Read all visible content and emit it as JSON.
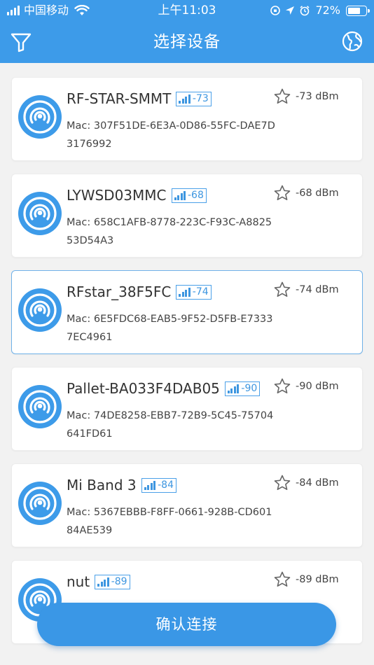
{
  "status_bar": {
    "carrier": "中国移动",
    "time": "上午11:03",
    "battery_percent": "72%",
    "battery_level": 0.72
  },
  "nav": {
    "title": "选择设备",
    "left_icon": "filter-icon",
    "right_icon": "globe-icon"
  },
  "colors": {
    "primary": "#3d9be9",
    "badge": "#3d96e0",
    "selected_border": "#6fb1e8"
  },
  "devices": [
    {
      "name": "RF-STAR-SMMT",
      "badge_rssi": "-73",
      "mac_label": "Mac: 307F51DE-6E3A-0D86-55FC-DAE7D3176992",
      "rssi_text": "-73 dBm",
      "selected": false
    },
    {
      "name": "LYWSD03MMC",
      "badge_rssi": "-68",
      "mac_label": "Mac: 658C1AFB-8778-223C-F93C-A882553D54A3",
      "rssi_text": "-68 dBm",
      "selected": false
    },
    {
      "name": "RFstar_38F5FC",
      "badge_rssi": "-74",
      "mac_label": "Mac: 6E5FDC68-EAB5-9F52-D5FB-E73337EC4961",
      "rssi_text": "-74 dBm",
      "selected": true
    },
    {
      "name": "Pallet-BA033F4DAB05",
      "badge_rssi": "-90",
      "mac_label": "Mac: 74DE8258-EBB7-72B9-5C45-75704641FD61",
      "rssi_text": "-90 dBm",
      "selected": false
    },
    {
      "name": "Mi Band 3",
      "badge_rssi": "-84",
      "mac_label": "Mac: 5367EBBB-F8FF-0661-928B-CD60184AE539",
      "rssi_text": "-84 dBm",
      "selected": false
    },
    {
      "name": "nut",
      "badge_rssi": "-89",
      "mac_label": "",
      "rssi_text": "-89 dBm",
      "selected": false
    }
  ],
  "confirm_button": {
    "label": "确认连接"
  }
}
